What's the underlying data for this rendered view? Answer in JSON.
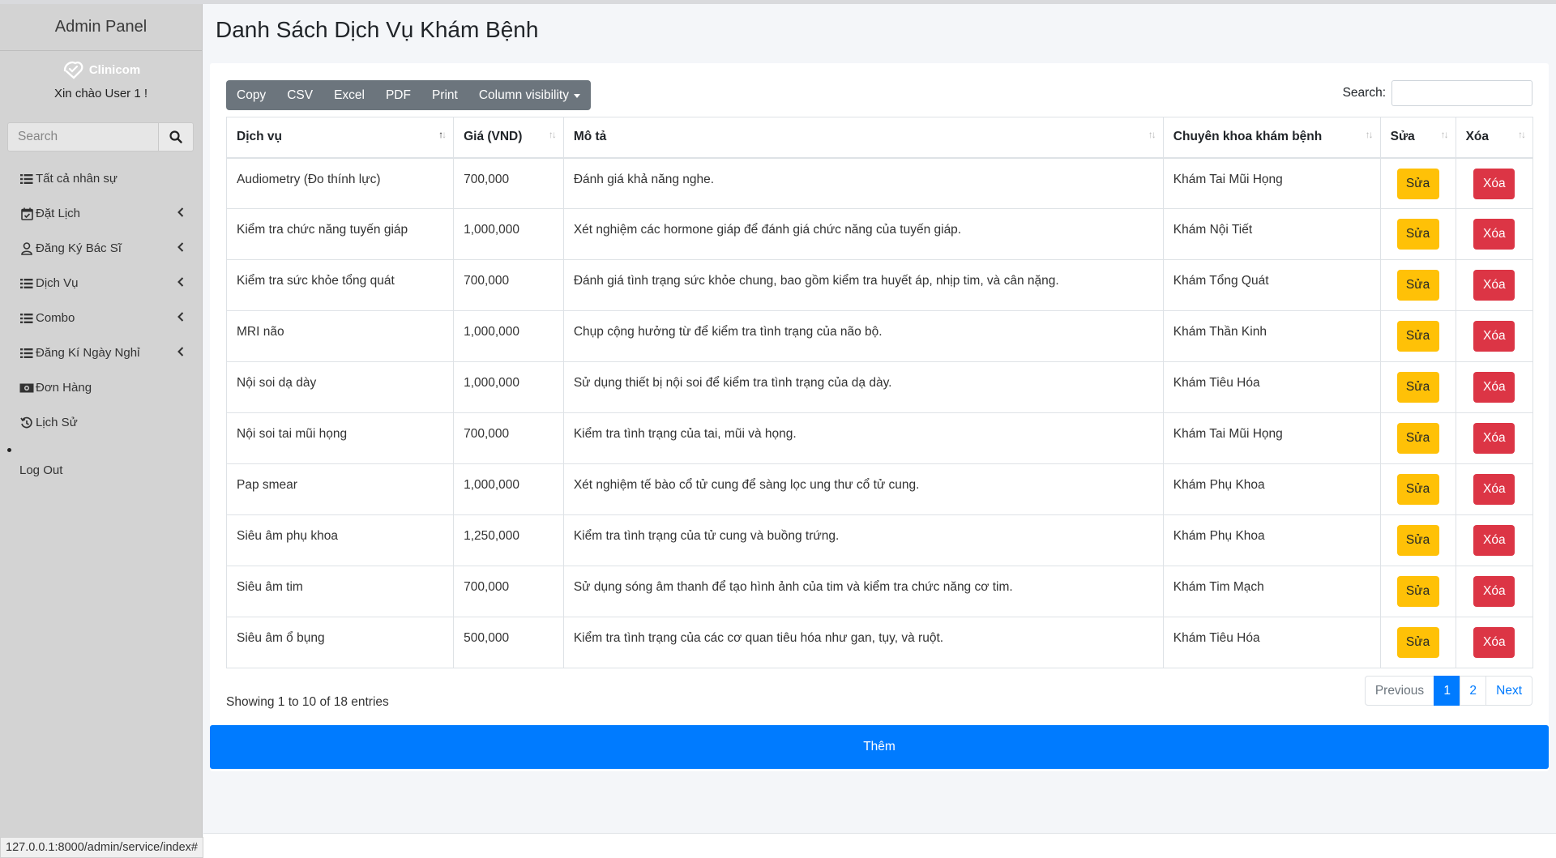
{
  "sidebar": {
    "brand": "Admin Panel",
    "logo_text": "Clinicom",
    "welcome": "Xin chào User 1 !",
    "search_placeholder": "Search",
    "items": [
      {
        "label": "Tất cả nhân sự",
        "icon": "list-icon",
        "has_chevron": false
      },
      {
        "label": "Đặt Lịch",
        "icon": "calendar-check-icon",
        "has_chevron": true
      },
      {
        "label": "Đăng Ký Bác Sĩ",
        "icon": "user-icon",
        "has_chevron": true
      },
      {
        "label": "Dịch Vụ",
        "icon": "list-icon",
        "has_chevron": true
      },
      {
        "label": "Combo",
        "icon": "list-icon",
        "has_chevron": true
      },
      {
        "label": "Đăng Kí Ngày Nghỉ",
        "icon": "list-icon",
        "has_chevron": true
      },
      {
        "label": "Đơn Hàng",
        "icon": "money-bill-icon",
        "has_chevron": false
      },
      {
        "label": "Lịch Sử",
        "icon": "history-icon",
        "has_chevron": false
      }
    ],
    "logout": "Log Out"
  },
  "status_url": "127.0.0.1:8000/admin/service/index#",
  "main": {
    "title": "Danh Sách Dịch Vụ Khám Bệnh",
    "export_buttons": [
      "Copy",
      "CSV",
      "Excel",
      "PDF",
      "Print"
    ],
    "column_visibility": "Column visibility",
    "search_label": "Search:",
    "search_value": "",
    "columns": [
      "Dịch vụ",
      "Giá (VND)",
      "Mô tả",
      "Chuyên khoa khám bệnh",
      "Sửa",
      "Xóa"
    ],
    "edit_label": "Sửa",
    "delete_label": "Xóa",
    "rows": [
      {
        "service": "Audiometry (Đo thính lực)",
        "price": "700,000",
        "description": "Đánh giá khả năng nghe.",
        "specialty": "Khám Tai Mũi Họng"
      },
      {
        "service": "Kiểm tra chức năng tuyến giáp",
        "price": "1,000,000",
        "description": "Xét nghiệm các hormone giáp để đánh giá chức năng của tuyến giáp.",
        "specialty": "Khám Nội Tiết"
      },
      {
        "service": "Kiểm tra sức khỏe tổng quát",
        "price": "700,000",
        "description": "Đánh giá tình trạng sức khỏe chung, bao gồm kiểm tra huyết áp, nhịp tim, và cân nặng.",
        "specialty": "Khám Tổng Quát"
      },
      {
        "service": "MRI não",
        "price": "1,000,000",
        "description": "Chụp cộng hưởng từ để kiểm tra tình trạng của não bộ.",
        "specialty": "Khám Thần Kinh"
      },
      {
        "service": "Nội soi dạ dày",
        "price": "1,000,000",
        "description": "Sử dụng thiết bị nội soi để kiểm tra tình trạng của dạ dày.",
        "specialty": "Khám Tiêu Hóa"
      },
      {
        "service": "Nội soi tai mũi họng",
        "price": "700,000",
        "description": "Kiểm tra tình trạng của tai, mũi và họng.",
        "specialty": "Khám Tai Mũi Họng"
      },
      {
        "service": "Pap smear",
        "price": "1,000,000",
        "description": "Xét nghiệm tế bào cổ tử cung để sàng lọc ung thư cổ tử cung.",
        "specialty": "Khám Phụ Khoa"
      },
      {
        "service": "Siêu âm phụ khoa",
        "price": "1,250,000",
        "description": "Kiểm tra tình trạng của tử cung và buồng trứng.",
        "specialty": "Khám Phụ Khoa"
      },
      {
        "service": "Siêu âm tim",
        "price": "700,000",
        "description": "Sử dụng sóng âm thanh để tạo hình ảnh của tim và kiểm tra chức năng cơ tim.",
        "specialty": "Khám Tim Mạch"
      },
      {
        "service": "Siêu âm ổ bụng",
        "price": "500,000",
        "description": "Kiểm tra tình trạng của các cơ quan tiêu hóa như gan, tụy, và ruột.",
        "specialty": "Khám Tiêu Hóa"
      }
    ],
    "info": "Showing 1 to 10 of 18 entries",
    "pagination": {
      "previous": "Previous",
      "pages": [
        "1",
        "2"
      ],
      "current": "1",
      "next": "Next"
    },
    "add_button": "Thêm"
  },
  "colors": {
    "sidebar_bg": "#d3d3d3",
    "primary": "#007bff",
    "warning": "#ffc107",
    "danger": "#dc3545",
    "secondary": "#6c757d"
  }
}
